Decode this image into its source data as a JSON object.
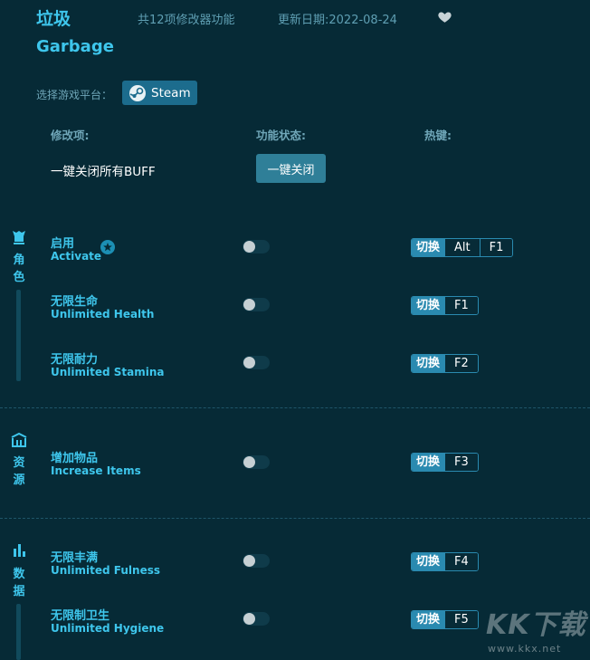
{
  "header": {
    "title_cn": "垃圾",
    "title_en": "Garbage",
    "feature_count": "共12项修改器功能",
    "update_date": "更新日期:2022-08-24"
  },
  "platform": {
    "label": "选择游戏平台：",
    "steam_label": "Steam"
  },
  "columns": {
    "item": "修改项:",
    "status": "功能状态:",
    "hotkey": "热键:"
  },
  "close_all": {
    "label": "一键关闭所有BUFF",
    "button": "一键关闭"
  },
  "sections": [
    {
      "name_chars": [
        "角",
        "色"
      ],
      "icon": "character-icon",
      "items": [
        {
          "cn": "启用",
          "en": "Activate",
          "starred": true,
          "toggle_on": false,
          "hotkey_switch": "切换",
          "keys": [
            "Alt",
            "F1"
          ]
        },
        {
          "cn": "无限生命",
          "en": "Unlimited Health",
          "toggle_on": false,
          "hotkey_switch": "切换",
          "keys": [
            "F1"
          ]
        },
        {
          "cn": "无限耐力",
          "en": "Unlimited Stamina",
          "toggle_on": false,
          "hotkey_switch": "切换",
          "keys": [
            "F2"
          ]
        }
      ]
    },
    {
      "name_chars": [
        "资",
        "源"
      ],
      "icon": "resources-icon",
      "items": [
        {
          "cn": "增加物品",
          "en": "Increase Items",
          "toggle_on": false,
          "hotkey_switch": "切换",
          "keys": [
            "F3"
          ]
        }
      ]
    },
    {
      "name_chars": [
        "数",
        "据"
      ],
      "icon": "stats-icon",
      "items": [
        {
          "cn": "无限丰满",
          "en": "Unlimited Fulness",
          "toggle_on": false,
          "hotkey_switch": "切换",
          "keys": [
            "F4"
          ]
        },
        {
          "cn": "无限制卫生",
          "en": "Unlimited Hygiene",
          "toggle_on": false,
          "hotkey_switch": "切换",
          "keys": [
            "F5"
          ]
        }
      ]
    }
  ],
  "watermark": {
    "logo": "KK下载",
    "url": "www.kkx.net"
  },
  "colors": {
    "background": "#062a36",
    "accent": "#3ec6ec",
    "button": "#2f7f98",
    "hotkey_border": "#2a8ab0"
  }
}
